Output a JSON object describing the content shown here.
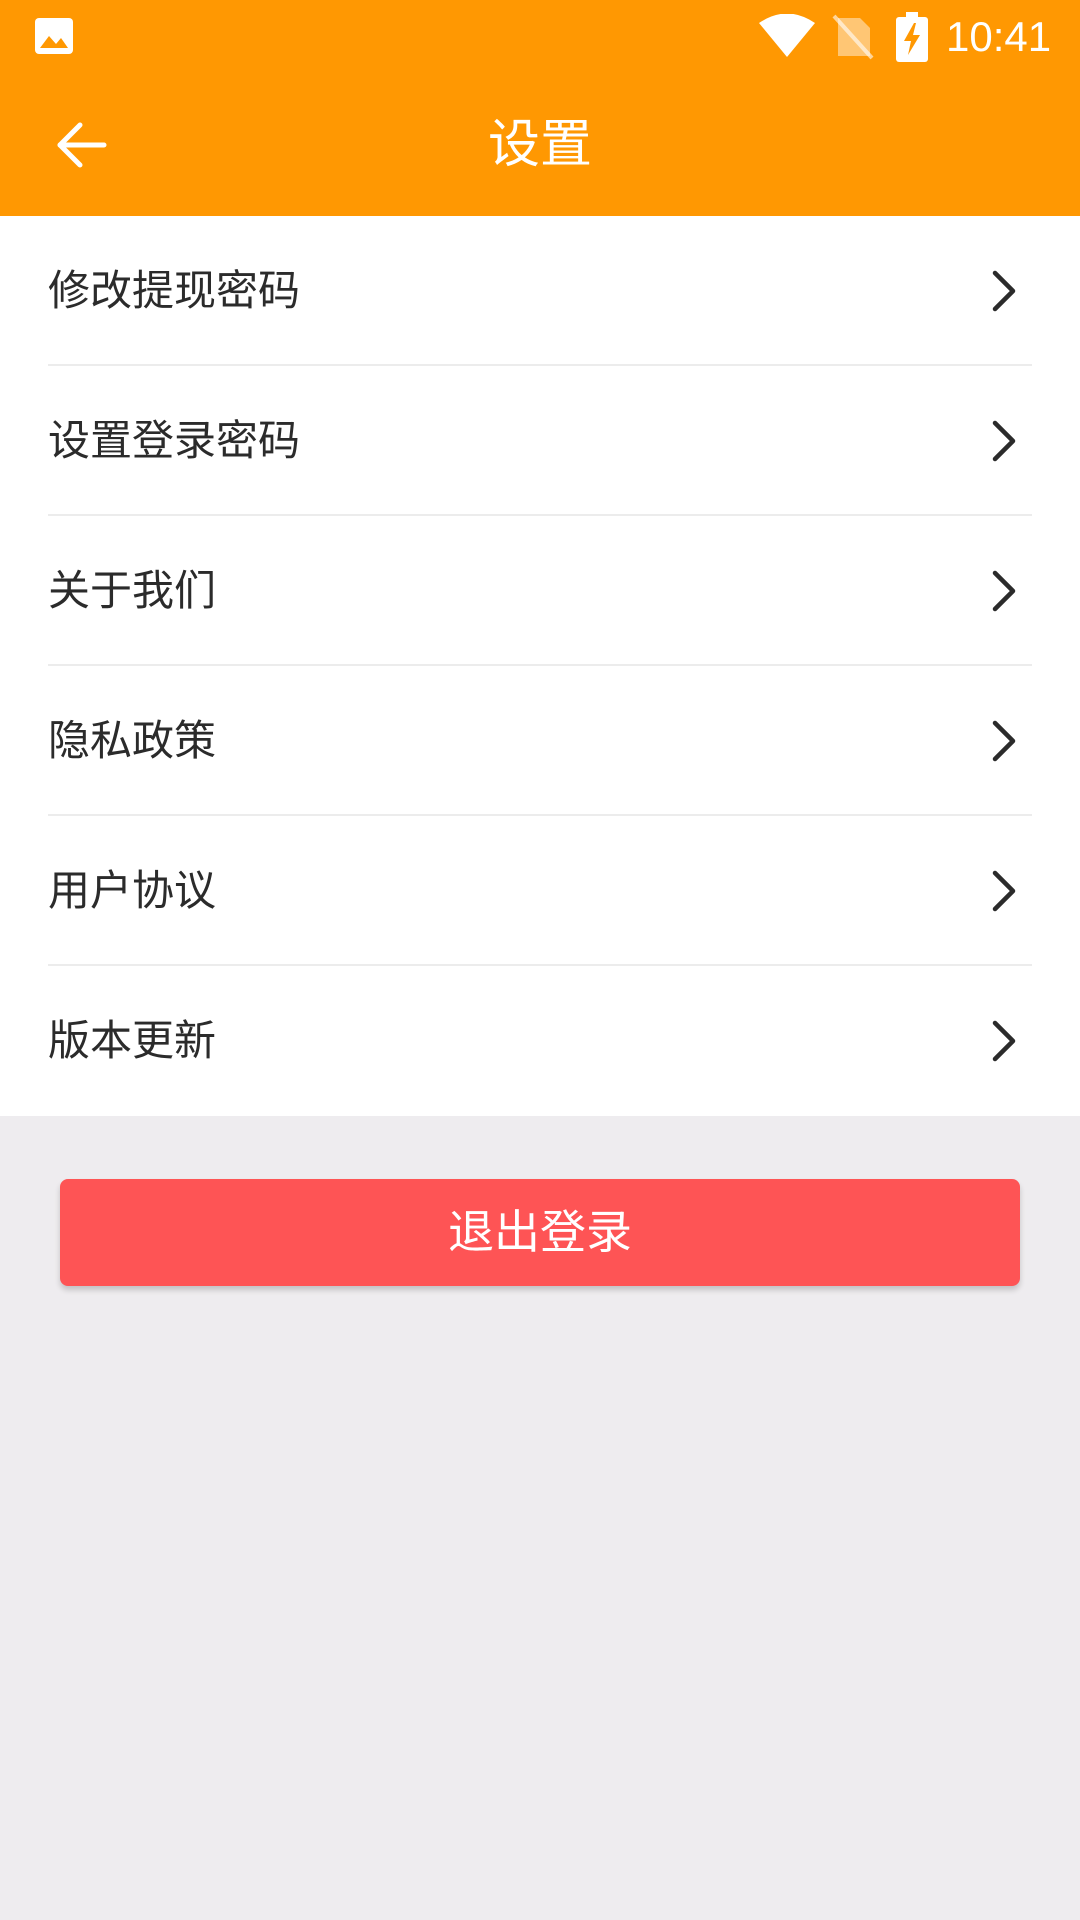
{
  "status_bar": {
    "time": "10:41",
    "icons": [
      "gallery-icon",
      "wifi-icon",
      "no-sim-icon",
      "battery-charging-icon"
    ]
  },
  "app_bar": {
    "back_icon": "arrow-back-icon",
    "title": "设置"
  },
  "menu": {
    "items": [
      {
        "label": "修改提现密码",
        "icon": "chevron-right-icon"
      },
      {
        "label": "设置登录密码",
        "icon": "chevron-right-icon"
      },
      {
        "label": "关于我们",
        "icon": "chevron-right-icon"
      },
      {
        "label": "隐私政策",
        "icon": "chevron-right-icon"
      },
      {
        "label": "用户协议",
        "icon": "chevron-right-icon"
      },
      {
        "label": "版本更新",
        "icon": "chevron-right-icon"
      }
    ]
  },
  "logout": {
    "label": "退出登录"
  },
  "colors": {
    "primary": "#FF9802",
    "danger": "#FE5455",
    "background": "#EEECEF",
    "surface": "#FFFFFF",
    "text": "#2B2B2B",
    "divider": "#ECECEC"
  }
}
